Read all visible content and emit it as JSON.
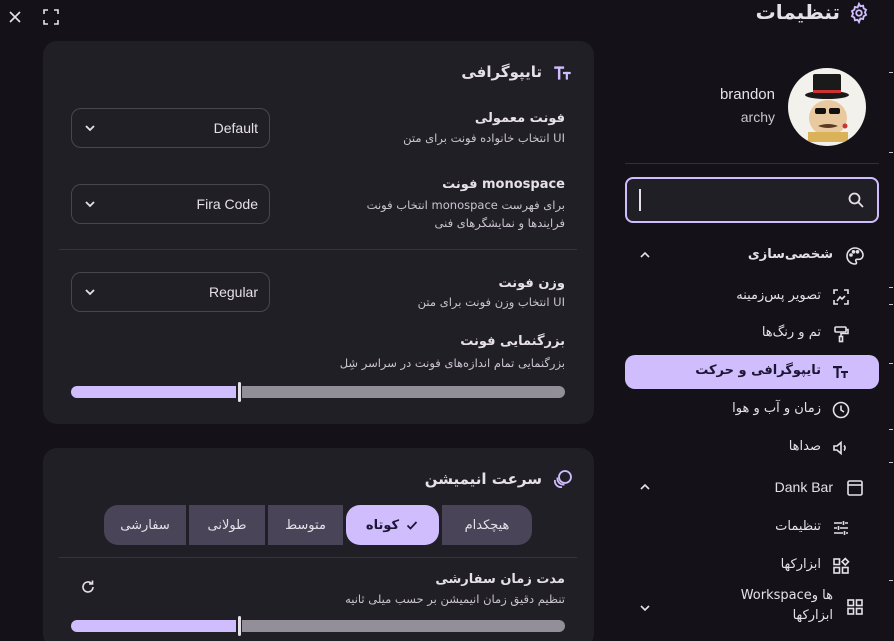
{
  "window": {
    "close_icon": "close-icon",
    "fullscreen_icon": "fullscreen-icon"
  },
  "header": {
    "title": "تنظیمات",
    "icon": "gear-icon"
  },
  "profile": {
    "name": "brandon",
    "subtitle": "archy"
  },
  "search": {
    "value": "",
    "icon": "search-icon"
  },
  "sidebar": {
    "items": [
      {
        "label": "شخصی‌سازی",
        "icon": "palette-icon",
        "type": "group",
        "expanded": true
      },
      {
        "label": "تصویر پس‌زمینه",
        "icon": "wallpaper-icon",
        "type": "item"
      },
      {
        "label": "تم و رنگ‌ها",
        "icon": "paint-roller-icon",
        "type": "item"
      },
      {
        "label": "تایپوگرافی و حرکت",
        "icon": "text-fields-icon",
        "type": "item",
        "active": true
      },
      {
        "label": "زمان و آب و هوا",
        "icon": "clock-icon",
        "type": "item"
      },
      {
        "label": "صداها",
        "icon": "volume-icon",
        "type": "item"
      },
      {
        "label": "Dank Bar",
        "icon": "dank-bar-icon",
        "type": "group",
        "expanded": true
      },
      {
        "label": "تنظیمات",
        "icon": "tune-icon",
        "type": "item"
      },
      {
        "label": "ابزارکها",
        "icon": "widgets-icon",
        "type": "item"
      },
      {
        "label": "Workspaceها و",
        "label2": "ابزارکها",
        "icon": "grid-icon",
        "type": "group",
        "expanded": false
      }
    ]
  },
  "typography": {
    "title": "تایپوگرافی",
    "icon": "text-fields-icon",
    "settings": {
      "normal_font": {
        "title": "فونت معمولی",
        "desc": "انتخاب خانواده فونت برای متن UI",
        "value": "Default"
      },
      "mono_font": {
        "title": "فونت monospace",
        "desc": "انتخاب فونت monospace برای فهرست",
        "desc2": "فرایندها و نمایشگرهای فنی",
        "value": "Fira Code"
      },
      "font_weight": {
        "title": "وزن فونت",
        "desc": "انتخاب وزن فونت برای متن UI",
        "value": "Regular"
      },
      "font_scale": {
        "title": "بزرگنمایی فونت",
        "desc": "بزرگنمایی تمام اندازه‌های فونت در سراسر شِل",
        "level": 0.34
      }
    }
  },
  "animation": {
    "title": "سرعت انیمیشن",
    "icon": "animation-icon",
    "options": [
      {
        "label": "هیچکدام",
        "selected": false
      },
      {
        "label": "کوتاه",
        "selected": true,
        "check_icon": "check-icon"
      },
      {
        "label": "متوسط",
        "selected": false
      },
      {
        "label": "طولانی",
        "selected": false
      },
      {
        "label": "سفارشی",
        "selected": false
      }
    ],
    "custom_duration": {
      "title": "مدت زمان سفارشی",
      "desc": "تنظیم دقیق زمان انیمیشن بر حسب میلی ثانیه",
      "reset_icon": "reset-icon",
      "level": 0.34
    }
  },
  "colors": {
    "background": "#141218",
    "card": "#211f26",
    "accent": "#cfbdfe",
    "segment": "#4a4458",
    "track": "#938f99"
  }
}
